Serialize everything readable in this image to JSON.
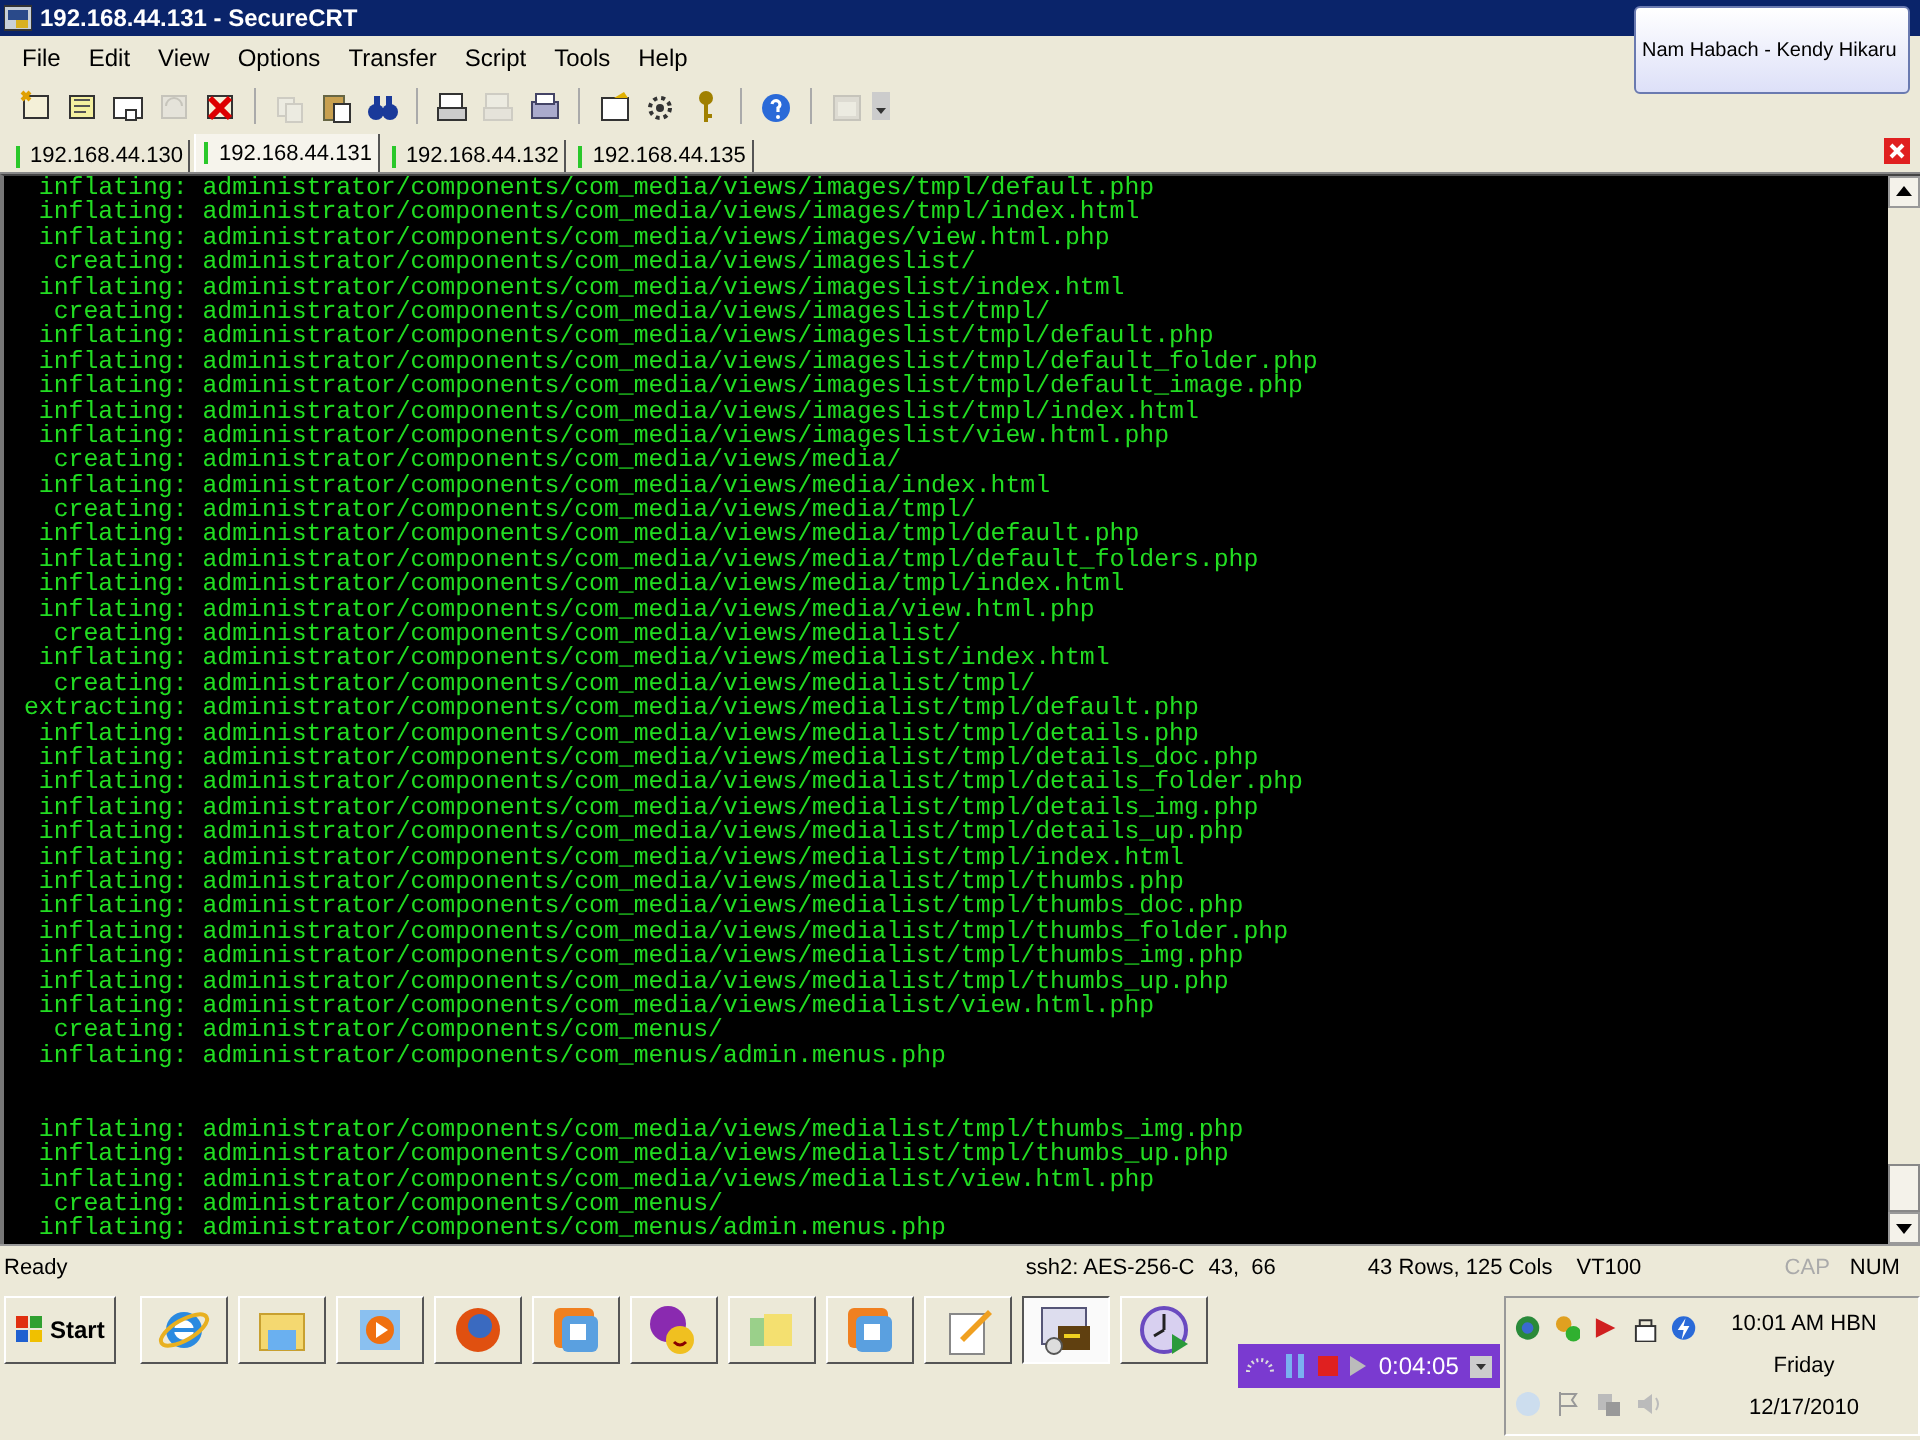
{
  "window": {
    "title": "192.168.44.131 - SecureCRT"
  },
  "tooltip": {
    "text": "Nam Habach - Kendy Hikaru"
  },
  "menu": [
    "File",
    "Edit",
    "View",
    "Options",
    "Transfer",
    "Script",
    "Tools",
    "Help"
  ],
  "toolbar": [
    {
      "disabled": false
    },
    {
      "disabled": false
    },
    {
      "disabled": false
    },
    {
      "disabled": true
    },
    {
      "disabled": false
    },
    {
      "disabled": true
    },
    {
      "disabled": false
    },
    {
      "disabled": false
    },
    {
      "disabled": false
    },
    {
      "disabled": true
    },
    {
      "disabled": false
    },
    {
      "disabled": false
    },
    {
      "disabled": false
    },
    {
      "disabled": false
    },
    {
      "disabled": false
    },
    {
      "disabled": true
    }
  ],
  "tabs": [
    {
      "label": "192.168.44.130",
      "selected": false
    },
    {
      "label": "192.168.44.131",
      "selected": true
    },
    {
      "label": "192.168.44.132",
      "selected": false
    },
    {
      "label": "192.168.44.135",
      "selected": false
    }
  ],
  "terminal": {
    "lines": [
      {
        "kind": "entry",
        "action": "inflating:",
        "path": "administrator/components/com_media/views/images/tmpl/default.php"
      },
      {
        "kind": "entry",
        "action": "inflating:",
        "path": "administrator/components/com_media/views/images/tmpl/index.html"
      },
      {
        "kind": "entry",
        "action": "inflating:",
        "path": "administrator/components/com_media/views/images/view.html.php"
      },
      {
        "kind": "entry",
        "action": "creating:",
        "path": "administrator/components/com_media/views/imageslist/"
      },
      {
        "kind": "entry",
        "action": "inflating:",
        "path": "administrator/components/com_media/views/imageslist/index.html"
      },
      {
        "kind": "entry",
        "action": "creating:",
        "path": "administrator/components/com_media/views/imageslist/tmpl/"
      },
      {
        "kind": "entry",
        "action": "inflating:",
        "path": "administrator/components/com_media/views/imageslist/tmpl/default.php"
      },
      {
        "kind": "entry",
        "action": "inflating:",
        "path": "administrator/components/com_media/views/imageslist/tmpl/default_folder.php"
      },
      {
        "kind": "entry",
        "action": "inflating:",
        "path": "administrator/components/com_media/views/imageslist/tmpl/default_image.php"
      },
      {
        "kind": "entry",
        "action": "inflating:",
        "path": "administrator/components/com_media/views/imageslist/tmpl/index.html"
      },
      {
        "kind": "entry",
        "action": "inflating:",
        "path": "administrator/components/com_media/views/imageslist/view.html.php"
      },
      {
        "kind": "entry",
        "action": "creating:",
        "path": "administrator/components/com_media/views/media/"
      },
      {
        "kind": "entry",
        "action": "inflating:",
        "path": "administrator/components/com_media/views/media/index.html"
      },
      {
        "kind": "entry",
        "action": "creating:",
        "path": "administrator/components/com_media/views/media/tmpl/"
      },
      {
        "kind": "entry",
        "action": "inflating:",
        "path": "administrator/components/com_media/views/media/tmpl/default.php"
      },
      {
        "kind": "entry",
        "action": "inflating:",
        "path": "administrator/components/com_media/views/media/tmpl/default_folders.php"
      },
      {
        "kind": "entry",
        "action": "inflating:",
        "path": "administrator/components/com_media/views/media/tmpl/index.html"
      },
      {
        "kind": "entry",
        "action": "inflating:",
        "path": "administrator/components/com_media/views/media/view.html.php"
      },
      {
        "kind": "entry",
        "action": "creating:",
        "path": "administrator/components/com_media/views/medialist/"
      },
      {
        "kind": "entry",
        "action": "inflating:",
        "path": "administrator/components/com_media/views/medialist/index.html"
      },
      {
        "kind": "entry",
        "action": "creating:",
        "path": "administrator/components/com_media/views/medialist/tmpl/"
      },
      {
        "kind": "entry",
        "action": "extracting:",
        "path": "administrator/components/com_media/views/medialist/tmpl/default.php"
      },
      {
        "kind": "entry",
        "action": "inflating:",
        "path": "administrator/components/com_media/views/medialist/tmpl/details.php"
      },
      {
        "kind": "entry",
        "action": "inflating:",
        "path": "administrator/components/com_media/views/medialist/tmpl/details_doc.php"
      },
      {
        "kind": "entry",
        "action": "inflating:",
        "path": "administrator/components/com_media/views/medialist/tmpl/details_folder.php"
      },
      {
        "kind": "entry",
        "action": "inflating:",
        "path": "administrator/components/com_media/views/medialist/tmpl/details_img.php"
      },
      {
        "kind": "entry",
        "action": "inflating:",
        "path": "administrator/components/com_media/views/medialist/tmpl/details_up.php"
      },
      {
        "kind": "entry",
        "action": "inflating:",
        "path": "administrator/components/com_media/views/medialist/tmpl/index.html"
      },
      {
        "kind": "entry",
        "action": "inflating:",
        "path": "administrator/components/com_media/views/medialist/tmpl/thumbs.php"
      },
      {
        "kind": "entry",
        "action": "inflating:",
        "path": "administrator/components/com_media/views/medialist/tmpl/thumbs_doc.php"
      },
      {
        "kind": "entry",
        "action": "inflating:",
        "path": "administrator/components/com_media/views/medialist/tmpl/thumbs_folder.php"
      },
      {
        "kind": "entry",
        "action": "inflating:",
        "path": "administrator/components/com_media/views/medialist/tmpl/thumbs_img.php"
      },
      {
        "kind": "entry",
        "action": "inflating:",
        "path": "administrator/components/com_media/views/medialist/tmpl/thumbs_up.php"
      },
      {
        "kind": "entry",
        "action": "inflating:",
        "path": "administrator/components/com_media/views/medialist/view.html.php"
      },
      {
        "kind": "entry",
        "action": "creating:",
        "path": "administrator/components/com_menus/"
      },
      {
        "kind": "entry",
        "action": "inflating:",
        "path": "administrator/components/com_menus/admin.menus.php"
      },
      {
        "kind": "blank"
      },
      {
        "kind": "blank"
      },
      {
        "kind": "entry",
        "action": "inflating:",
        "path": "administrator/components/com_media/views/medialist/tmpl/thumbs_img.php"
      },
      {
        "kind": "entry",
        "action": "inflating:",
        "path": "administrator/components/com_media/views/medialist/tmpl/thumbs_up.php"
      },
      {
        "kind": "entry",
        "action": "inflating:",
        "path": "administrator/components/com_media/views/medialist/view.html.php"
      },
      {
        "kind": "entry",
        "action": "creating:",
        "path": "administrator/components/com_menus/"
      },
      {
        "kind": "entry",
        "action": "inflating:",
        "path": "administrator/components/com_menus/admin.menus.php"
      }
    ]
  },
  "status_bar": {
    "message": "Ready",
    "cipher": "ssh2: AES-256-C",
    "cursor": "43,  66",
    "size": "43 Rows, 125 Cols",
    "emulation": "VT100",
    "indicators": [
      {
        "label": "CAP",
        "on": false
      },
      {
        "label": "NUM",
        "on": true
      }
    ]
  },
  "taskbar": {
    "start": "Start",
    "buttons": [
      {
        "selected": false
      },
      {
        "selected": false
      },
      {
        "selected": false
      },
      {
        "selected": false
      },
      {
        "selected": false
      },
      {
        "selected": false
      },
      {
        "selected": false
      },
      {
        "selected": false
      },
      {
        "selected": false
      },
      {
        "selected": true
      },
      {
        "selected": false
      }
    ],
    "recorder": {
      "time": "0:04:05"
    },
    "clock": {
      "time": "10:01 AM HBN",
      "day": "Friday",
      "date": "12/17/2010"
    }
  }
}
